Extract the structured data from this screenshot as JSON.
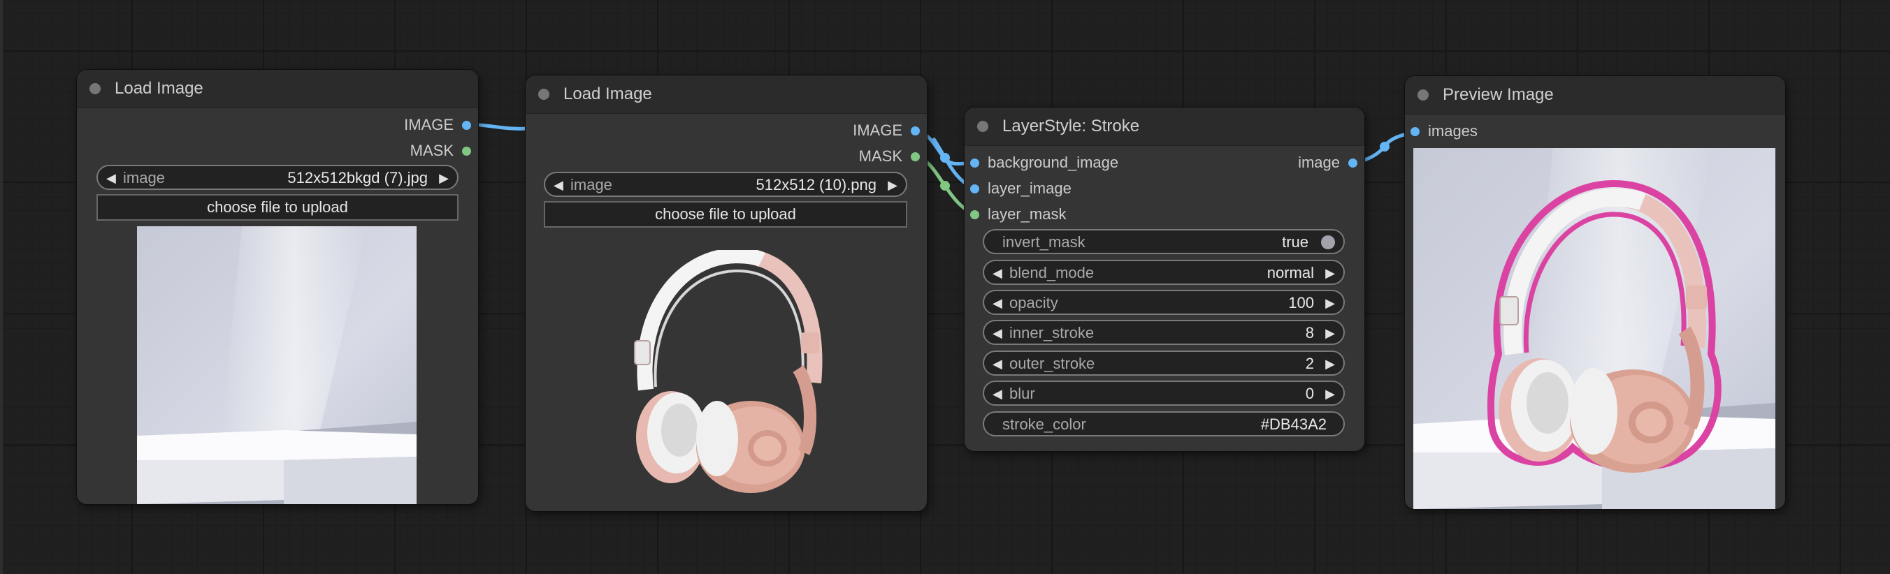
{
  "nodes": {
    "load_image_1": {
      "title": "Load Image",
      "outputs": [
        "IMAGE",
        "MASK"
      ],
      "image_widget": {
        "label": "image",
        "value": "512x512bkgd (7).jpg"
      },
      "upload_label": "choose file to upload"
    },
    "load_image_2": {
      "title": "Load Image",
      "outputs": [
        "IMAGE",
        "MASK"
      ],
      "image_widget": {
        "label": "image",
        "value": "512x512 (10).png"
      },
      "upload_label": "choose file to upload"
    },
    "stroke": {
      "title": "LayerStyle: Stroke",
      "inputs": [
        "background_image",
        "layer_image",
        "layer_mask"
      ],
      "output": "image",
      "widgets": [
        {
          "label": "invert_mask",
          "value": "true"
        },
        {
          "label": "blend_mode",
          "value": "normal"
        },
        {
          "label": "opacity",
          "value": "100"
        },
        {
          "label": "inner_stroke",
          "value": "8"
        },
        {
          "label": "outer_stroke",
          "value": "2"
        },
        {
          "label": "blur",
          "value": "0"
        },
        {
          "label": "stroke_color",
          "value": "#DB43A2"
        }
      ]
    },
    "preview": {
      "title": "Preview Image",
      "input": "images"
    }
  },
  "colors": {
    "image_link": "#64b5f6",
    "mask_link": "#81c784",
    "stroke_color": "#DB43A2"
  },
  "icons": {
    "arrow_left": "◀",
    "arrow_right": "▶"
  }
}
